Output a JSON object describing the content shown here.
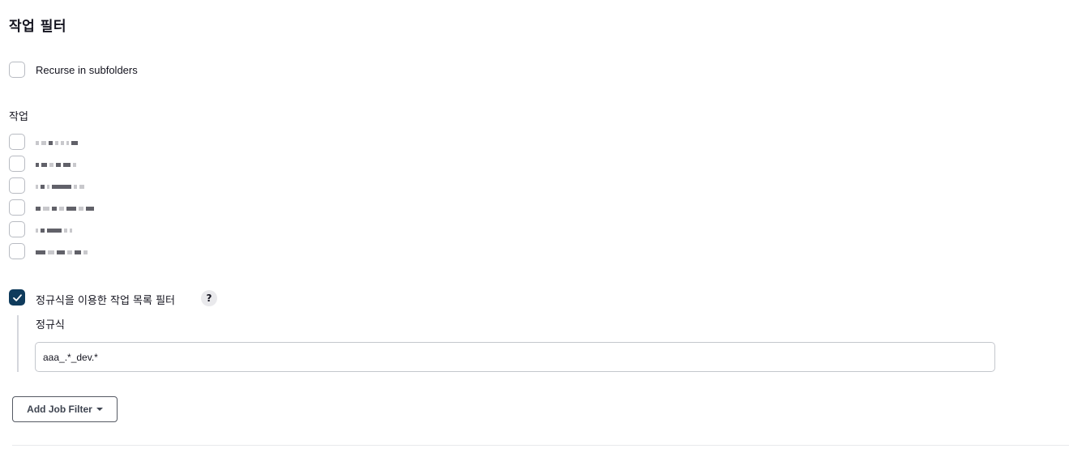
{
  "section": {
    "title": "작업 필터"
  },
  "recurse": {
    "label": "Recurse in subfolders",
    "checked": false
  },
  "jobs": {
    "label": "작업",
    "items": [
      {
        "checked": false,
        "name_redacted": true
      },
      {
        "checked": false,
        "name_redacted": true
      },
      {
        "checked": false,
        "name_redacted": true
      },
      {
        "checked": false,
        "name_redacted": true
      },
      {
        "checked": false,
        "name_redacted": true
      },
      {
        "checked": false,
        "name_redacted": true
      }
    ]
  },
  "regex_filter": {
    "label": "정규식을 이용한 작업 목록 필터",
    "checked": true,
    "help_symbol": "?",
    "field_label": "정규식",
    "value": "aaa_.*_dev.*"
  },
  "add_filter": {
    "label": "Add Job Filter"
  },
  "colors": {
    "checkbox_checked": "#0f3b5c",
    "checkbox_border": "#b8bbc2"
  }
}
